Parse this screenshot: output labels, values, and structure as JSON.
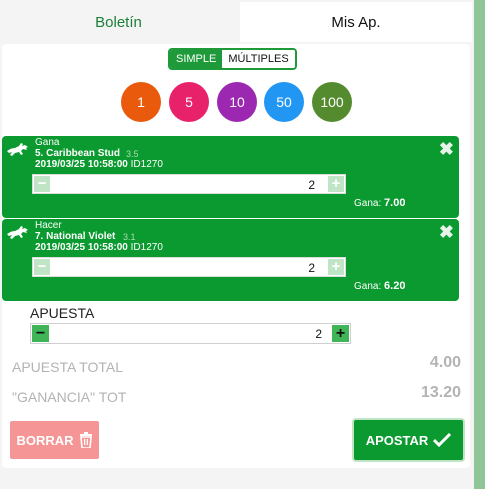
{
  "tabs": {
    "boletin": "Boletín",
    "mis_ap": "Mis Ap."
  },
  "mode": {
    "simple": "SIMPLE",
    "multiples": "MÚLTIPLES",
    "selected": "SIMPLE"
  },
  "chips": [
    {
      "label": "1",
      "color": "#e95a0c"
    },
    {
      "label": "5",
      "color": "#e8216b"
    },
    {
      "label": "10",
      "color": "#9c27b0"
    },
    {
      "label": "50",
      "color": "#2196f3"
    },
    {
      "label": "100",
      "color": "#558b2f"
    }
  ],
  "bets": [
    {
      "type": "Gana",
      "runner": "5. Caribbean Stud",
      "odds": "3.5",
      "datetime": "2019/03/25 10:58:00",
      "race_id": "ID1270",
      "stake": "2",
      "win_label": "Gana:",
      "win_value": "7.00"
    },
    {
      "type": "Hacer",
      "runner": "7. National Violet",
      "odds": "3.1",
      "datetime": "2019/03/25 10:58:00",
      "race_id": "ID1270",
      "stake": "2",
      "win_label": "Gana:",
      "win_value": "6.20"
    }
  ],
  "stake": {
    "label": "APUESTA",
    "value": "2"
  },
  "summary": {
    "total_label": "APUESTA TOTAL",
    "total_value": "4.00",
    "gain_label": "\"GANANCIA\" TOT",
    "gain_value": "13.20"
  },
  "actions": {
    "clear": "BORRAR",
    "place": "APOSTAR"
  },
  "colors": {
    "brand_green": "#0a9a2f",
    "clear_red": "#f69595"
  }
}
